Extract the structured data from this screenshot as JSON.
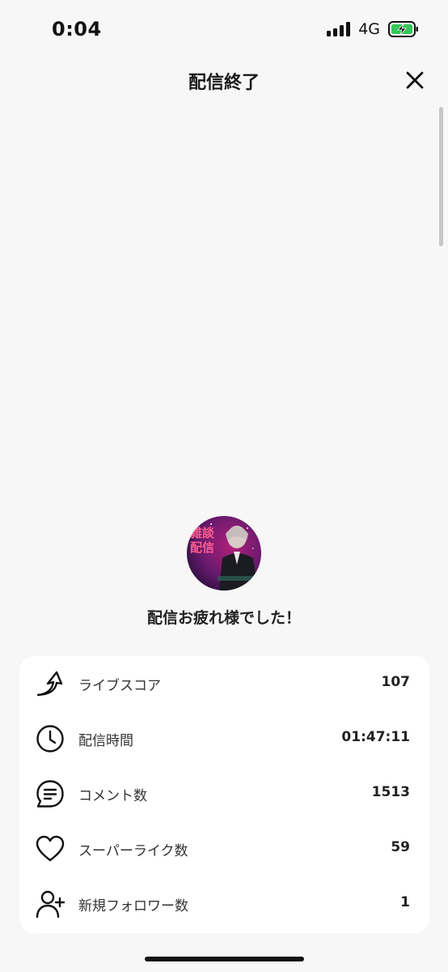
{
  "status_bar": {
    "time": "0:04",
    "network": "4G"
  },
  "header": {
    "title": "配信終了"
  },
  "avatar": {
    "overlay_text": "雑談配信"
  },
  "message": "配信お疲れ様でした！",
  "stats": [
    {
      "icon": "trending-arrow-icon",
      "label": "ライブスコア",
      "value": "107"
    },
    {
      "icon": "clock-icon",
      "label": "配信時間",
      "value": "01:47:11"
    },
    {
      "icon": "comment-icon",
      "label": "コメント数",
      "value": "1513"
    },
    {
      "icon": "heart-icon",
      "label": "スーパーライク数",
      "value": "59"
    },
    {
      "icon": "add-user-icon",
      "label": "新規フォロワー数",
      "value": "1"
    }
  ],
  "colors": {
    "background": "#f7f7f7",
    "card": "#ffffff",
    "battery_green": "#34c759"
  }
}
